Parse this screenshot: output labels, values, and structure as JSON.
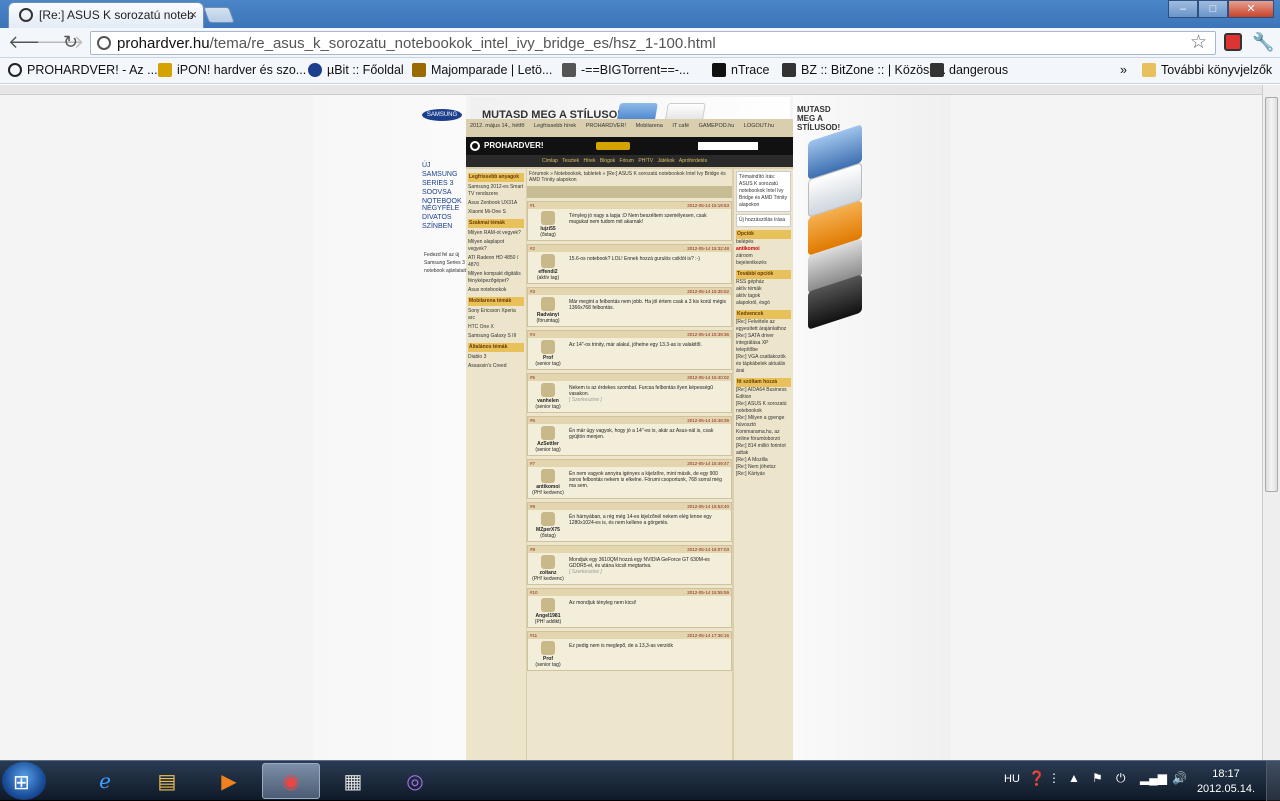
{
  "browser": {
    "tab_title": "[Re:] ASUS K sorozatú noteb",
    "tab_close": "×",
    "url_host": "prohardver.hu",
    "url_path": "/tema/re_asus_k_sorozatu_notebookok_intel_ivy_bridge_es/hsz_1-100.html",
    "window_buttons": [
      "–",
      "□",
      "✕"
    ],
    "bookmarks": [
      {
        "label": "PROHARDVER! - Az ...",
        "color": "#222222"
      },
      {
        "label": "iPON! hardver és szo...",
        "color": "#d4a300"
      },
      {
        "label": "µBit :: Főoldal",
        "color": "#1b3f8c"
      },
      {
        "label": "Majomparade | Letö...",
        "color": "#9a6a00"
      },
      {
        "label": "-==BIGTorrent==-...",
        "color": "#555555"
      },
      {
        "label": "nTrace",
        "color": "#111111"
      },
      {
        "label": "BZ :: BitZone :: | Közöss...",
        "color": "#333333"
      },
      {
        "label": "dangerous",
        "color": "#333333"
      }
    ],
    "other_bookmarks": "További könyvjelzők"
  },
  "ad": {
    "top_banner": "MUTASD MEG A STÍLUSOD!",
    "left_promo": "ÚJ SAMSUNG SERIES 3 SOOVSA NOTEBOOK",
    "left_promo2": "NÉGYFÉLE DIVATOS SZÍNBEN",
    "right_promo": "MUTASD MEG A STÍLUSOD!",
    "samsung": "SAMSUNG",
    "left_small": "Fedezd fel az új Samsung Series 3 notebook ajánlatait"
  },
  "page": {
    "date": "2012. május 14., hétfő",
    "links": [
      "Legfrissebb hírek",
      "PROHARDVER!",
      "Mobilarena",
      "IT café",
      "GAMEPOD.hu",
      "LOGOUT.hu"
    ],
    "brand": "PROHARDVER!",
    "menu": [
      "Címlap",
      "Tesztek",
      "Hírek",
      "Blogok",
      "Fórum",
      "PH!TV",
      "Játékok",
      "Apróhirdetés"
    ],
    "breadcrumb": "Fórumok » Notebookok, tabletek » [Re:] ASUS K sorozatú notebookok Intel Ivy Bridge és AMD Trinity alapokon",
    "left_sidebar": {
      "sections": [
        {
          "title": "Legfrissebb anyagok",
          "items": [
            "Samsung 2012-es Smart TV rendszere",
            "Asus Zenbook UX31A",
            "Xiaomi Mi-One S"
          ]
        },
        {
          "title": "Szakmai témák",
          "items": [
            "Milyen RAM-ot vegyek?",
            "Milyen alaplapot vegyek?",
            "ATI Radeon HD 4850 / 4870",
            "Milyen kompakt digitális fényképezőgépet?",
            "Asus notebookok"
          ]
        },
        {
          "title": "Mobilarena témák",
          "items": [
            "Sony Ericsson Xperia arc",
            "HTC One X",
            "Samsung Galaxy S III"
          ]
        },
        {
          "title": "Általános témák",
          "items": [
            "Diablo 3",
            "Assassin's Creed"
          ]
        }
      ]
    },
    "posts": [
      {
        "num": "#1",
        "user": "lujzi55",
        "rank": "(őstag)",
        "date": "2012-05-14 15:19:53",
        "text": "Tényleg jó nagy a lapja :D Nem beszéltem személyesen, csak magukat nem tudom mit akarnak!"
      },
      {
        "num": "#2",
        "user": "effendi2",
        "rank": "(aktív tag)",
        "date": "2012-05-14 15:32:48",
        "text": "15.6-os notebook? LOL! Ennek hozzá gurulós csiklót is? :-)"
      },
      {
        "num": "#3",
        "user": "Radványi",
        "rank": "(fórumtag)",
        "date": "2012-05-14 15:35:52",
        "text": "Már megint a felbontás nem jobb. Ha jól értem csak a 3 kis korúl mégis 1366x768 felbontás."
      },
      {
        "num": "#4",
        "user": "Prof",
        "rank": "(senior tag)",
        "date": "2012-05-14 15:39:36",
        "text": "Az 14\"-os trinity, már alakul, jöhetne egy 13.3-as is valakitől."
      },
      {
        "num": "#5",
        "user": "vanhelen",
        "rank": "(senior tag)",
        "date": "2012-05-14 15:40:02",
        "text": "Nekem is az érdekes szombat. Furcsa felbontás ilyen képességű vasakon.",
        "quote": "[ Szerkesztve ]"
      },
      {
        "num": "#6",
        "user": "AzSettler",
        "rank": "(senior tag)",
        "date": "2012-05-14 15:48:39",
        "text": "Én már úgy vagyok, hogy jó a 14\"-es is, akár az Asus-nál is, csak gyújtón menjen."
      },
      {
        "num": "#7",
        "user": "antikomoi",
        "rank": "(PH! kedvenc)",
        "date": "2012-05-14 15:49:47",
        "text": "Én nem vagyok annyira igényes a kijelzőre, mint másik, de egy 900 soros felbontás nekem is elkelne. Fórumi csoportunk, 768 sorral még ma sem."
      },
      {
        "num": "#8",
        "user": "MZperX75",
        "rank": "(őstag)",
        "date": "2012-05-14 15:53:40",
        "text": "Én hárnyában, a rég még 14-es kijelzőnél nekem elég lenne egy 1280x1024-es is, és nem kellene a görgetés."
      },
      {
        "num": "#9",
        "user": "zoltanz",
        "rank": "(PH! kedvenc)",
        "date": "2012-05-14 16:07:03",
        "text": "Mondjuk egy 3610QM hozzá egy NVIDIA GeForce GT 630M-es GDDR5-el, és utána kicsit megtartva.",
        "quote": "[ Szerkesztve ]"
      },
      {
        "num": "#10",
        "user": "Angel1981",
        "rank": "(PH! addikt)",
        "date": "2012-05-14 15:55:59",
        "text": "Az mondjuk tényleg nem kicsi!"
      },
      {
        "num": "#11",
        "user": "Prof",
        "rank": "(senior tag)",
        "date": "2012-05-14 17:36:16",
        "text": "Ez pedig nem is meglepő, de a 13,3-as verziók"
      }
    ],
    "right_sidebar": {
      "topic": "Témaindító írás: ASUS K sorozatú notebookok Intel Ivy Bridge és AMD Trinity alapokon",
      "new_comment": "Új hozzászólás írása",
      "options_title": "Opciók",
      "options": [
        "belépés",
        "antikomoi",
        "zároom",
        "bejelentkezés"
      ],
      "more_title": "További opciók",
      "more": [
        "RSS gépház",
        "aktív témák",
        "aktív tagok",
        "alapokról, ésgó"
      ],
      "fav_title": "Kedvencek",
      "fav": [
        "[Re:] Felvétele az egyesített árajánlathoz",
        "[Re:] SATA driver integrálása XP telepítőbe",
        "[Re:] VGA csatlakozók és tápkábelek aktuális árai"
      ],
      "bottom_title": "Itt szóltam hozzá",
      "bottom": [
        "[Re:] AIDA64 Business Edition",
        "[Re:] ASUS K sorozatú notebookok",
        "[Re:] Milyen a gyenge húvosztó",
        "Kommarama.hu, az online fórumtoborzó",
        "[Re:] 814 millió forintot adtak",
        "[Re:] A Mozilla",
        "[Re:] Nem jöhetsz",
        "[Re:] Kártyás"
      ]
    }
  },
  "taskbar": {
    "lang": "HU",
    "time": "18:17",
    "date": "2012.05.14."
  }
}
